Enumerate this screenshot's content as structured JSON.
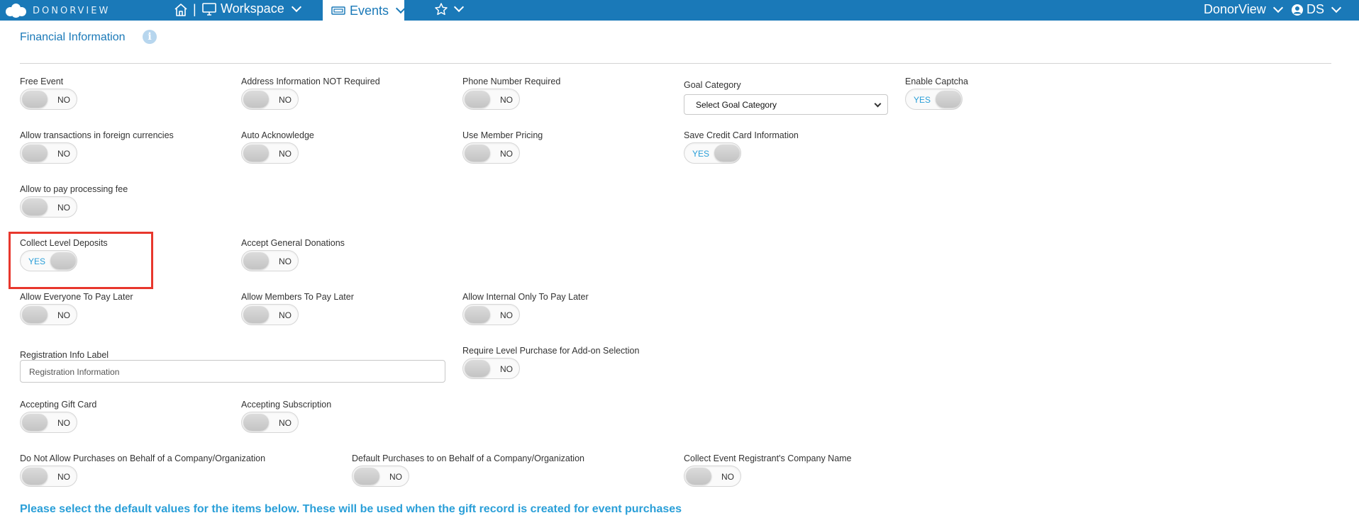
{
  "topbar": {
    "logo_text": "DONORVIEW",
    "workspace_label": "Workspace",
    "events_label": "Events",
    "org_label": "DonorView",
    "user_initials": "DS"
  },
  "section": {
    "title": "Financial Information",
    "info_icon": "i"
  },
  "fields": {
    "free_event": {
      "label": "Free Event",
      "value": "NO"
    },
    "address_not_required": {
      "label": "Address Information NOT Required",
      "value": "NO"
    },
    "phone_required": {
      "label": "Phone Number Required",
      "value": "NO"
    },
    "goal_category": {
      "label": "Goal Category",
      "selected": "Select Goal Category"
    },
    "enable_captcha": {
      "label": "Enable Captcha",
      "value": "YES"
    },
    "foreign_currencies": {
      "label": "Allow transactions in foreign currencies",
      "value": "NO"
    },
    "auto_acknowledge": {
      "label": "Auto Acknowledge",
      "value": "NO"
    },
    "member_pricing": {
      "label": "Use Member Pricing",
      "value": "NO"
    },
    "save_credit_card": {
      "label": "Save Credit Card Information",
      "value": "YES"
    },
    "processing_fee": {
      "label": "Allow to pay processing fee",
      "value": "NO"
    },
    "collect_level_deposits": {
      "label": "Collect Level Deposits",
      "value": "YES"
    },
    "accept_general_donations": {
      "label": "Accept General Donations",
      "value": "NO"
    },
    "everyone_pay_later": {
      "label": "Allow Everyone To Pay Later",
      "value": "NO"
    },
    "members_pay_later": {
      "label": "Allow Members To Pay Later",
      "value": "NO"
    },
    "internal_pay_later": {
      "label": "Allow Internal Only To Pay Later",
      "value": "NO"
    },
    "registration_info_label": {
      "label": "Registration Info Label",
      "value": "Registration Information"
    },
    "require_level_purchase": {
      "label": "Require Level Purchase for Add-on Selection",
      "value": "NO"
    },
    "accepting_gift_card": {
      "label": "Accepting Gift Card",
      "value": "NO"
    },
    "accepting_subscription": {
      "label": "Accepting Subscription",
      "value": "NO"
    },
    "no_purchases_behalf": {
      "label": "Do Not Allow Purchases on Behalf of a Company/Organization",
      "value": "NO"
    },
    "default_purchases_behalf": {
      "label": "Default Purchases to on Behalf of a Company/Organization",
      "value": "NO"
    },
    "collect_company_name": {
      "label": "Collect Event Registrant's Company Name",
      "value": "NO"
    }
  },
  "bottom_note": "Please select the default values for the items below. These will be used when the gift record is created for event purchases",
  "colors": {
    "topbar": "#1a79b8",
    "accent": "#2a9fd8",
    "highlight": "#e8372d"
  }
}
